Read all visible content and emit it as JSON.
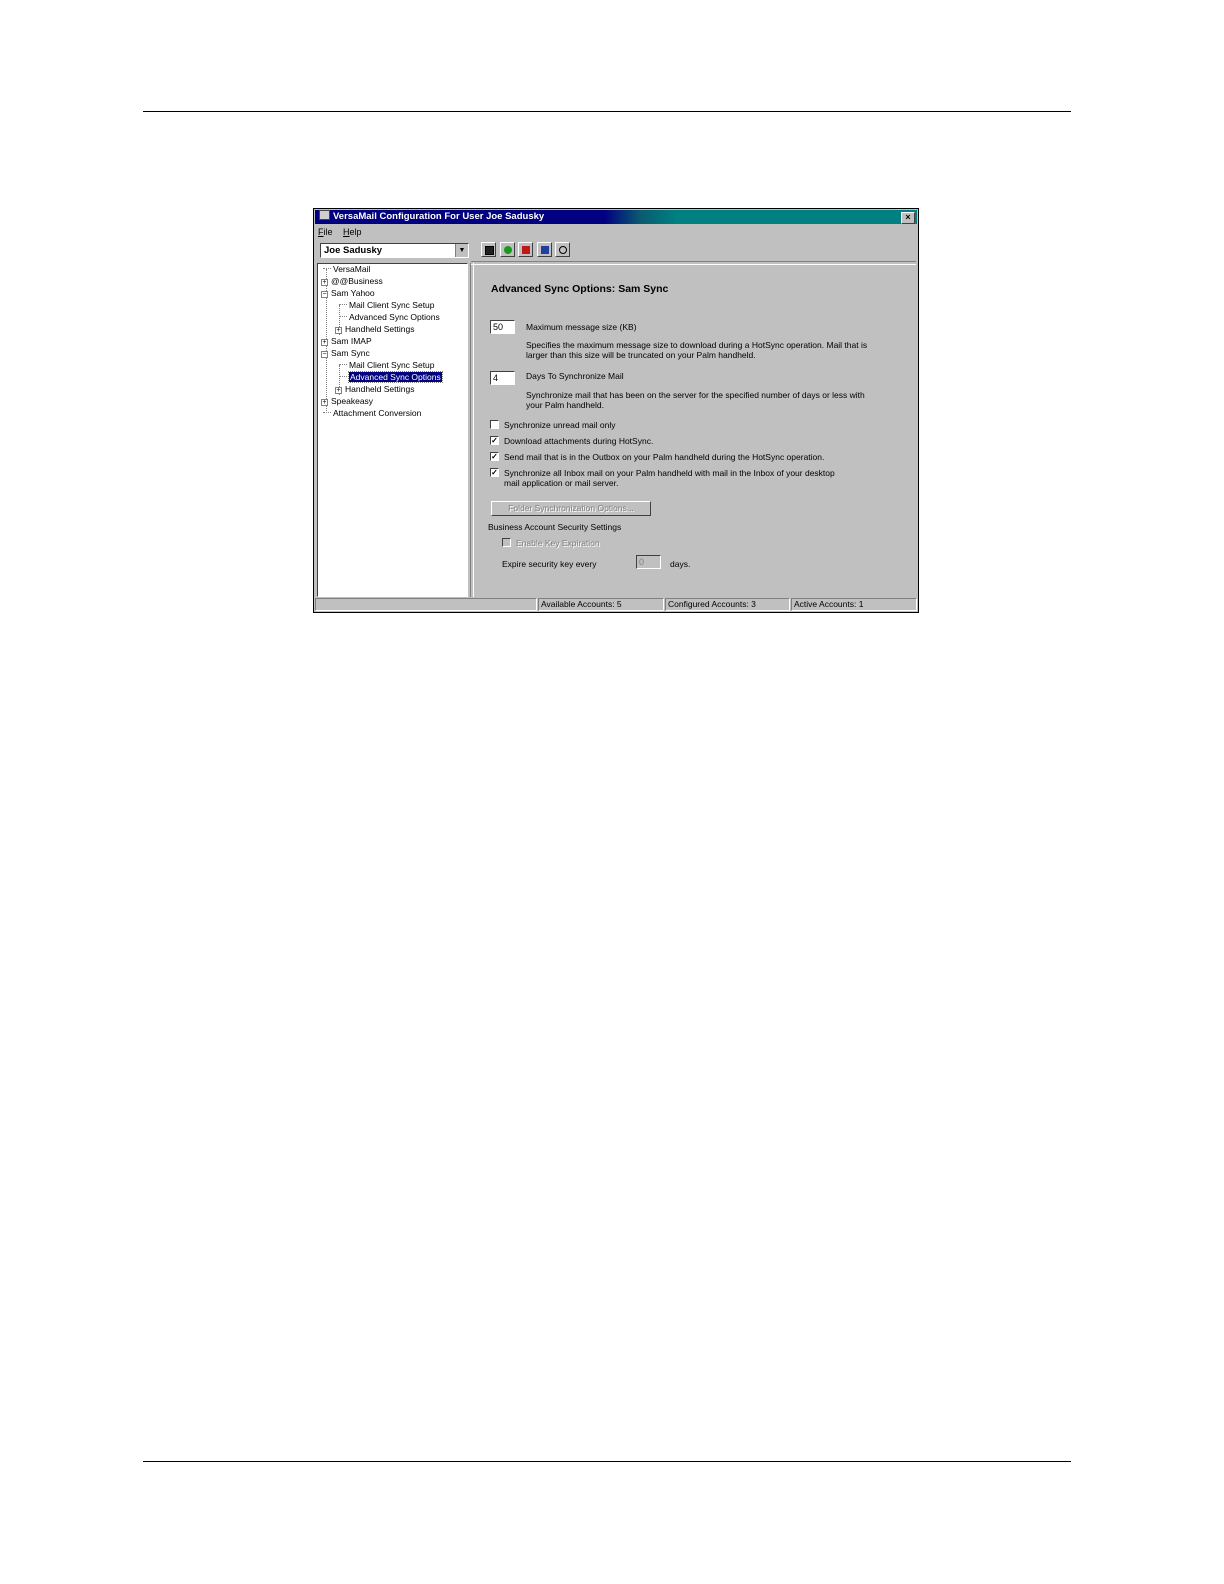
{
  "window": {
    "title": "VersaMail Configuration For User Joe Sadusky",
    "close_glyph": "×"
  },
  "menu": {
    "file": "File",
    "help": "Help"
  },
  "user_select": {
    "value": "Joe Sadusky",
    "arrow": "▼"
  },
  "tree": {
    "items": [
      {
        "label": "VersaMail"
      },
      {
        "label": "@@Business",
        "expander": "+"
      },
      {
        "label": "Sam Yahoo",
        "expander": "−"
      },
      {
        "label": "Mail Client Sync Setup"
      },
      {
        "label": "Advanced Sync Options"
      },
      {
        "label": "Handheld Settings",
        "expander": "+"
      },
      {
        "label": "Sam IMAP",
        "expander": "+"
      },
      {
        "label": "Sam Sync",
        "expander": "−"
      },
      {
        "label": "Mail Client Sync Setup"
      },
      {
        "label": "Advanced Sync Options",
        "selected": true
      },
      {
        "label": "Handheld Settings",
        "expander": "+"
      },
      {
        "label": "Speakeasy",
        "expander": "+"
      },
      {
        "label": "Attachment Conversion"
      }
    ]
  },
  "content": {
    "heading": "Advanced Sync Options: Sam Sync",
    "max_size": {
      "value": "50",
      "label": "Maximum message size (KB)",
      "description": "Specifies the maximum message size to download during a HotSync operation. Mail that is larger than this size will be truncated on your Palm handheld."
    },
    "days": {
      "value": "4",
      "label": "Days To Synchronize Mail",
      "description": "Synchronize mail that has been on the server for the specified number of days or less with your Palm handheld."
    },
    "checkboxes": [
      {
        "label": "Synchronize unread mail only",
        "checked": false
      },
      {
        "label": "Download attachments during HotSync.",
        "checked": true
      },
      {
        "label": "Send mail that is in the Outbox on your Palm handheld during the HotSync operation.",
        "checked": true
      },
      {
        "label": "Synchronize all Inbox mail on your Palm handheld with mail in the Inbox of your desktop mail application or mail server.",
        "checked": true
      }
    ],
    "check_glyph": "✓",
    "folder_button": "Folder Synchronization Options...",
    "security_group": "Business Account Security Settings",
    "enable_key_expiration": "Enable Key Expiration",
    "expire_label": "Expire security key every",
    "expire_value": "0",
    "days_suffix": "days."
  },
  "status": {
    "available": "Available Accounts: 5",
    "configured": "Configured Accounts: 3",
    "active": "Active Accounts: 1"
  },
  "colors": {
    "title_active": "#000080",
    "title_gradient_end": "#008080",
    "window_face": "#c0c0c0",
    "selection": "#000080"
  }
}
